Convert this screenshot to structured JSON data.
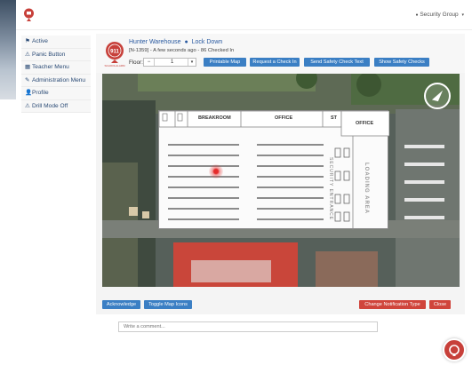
{
  "colors": {
    "brand_red": "#c7403a",
    "link_blue": "#2a5aa0",
    "button_blue": "#3b7fc4",
    "button_red": "#d0443b"
  },
  "topbar": {
    "user_menu": "Security Group",
    "logo_icon": "alarm-logo-icon"
  },
  "sidebar": {
    "items": [
      {
        "label": "Active",
        "icon": "flag-icon"
      },
      {
        "label": "Panic Button",
        "icon": "warning-icon"
      },
      {
        "label": "Teacher Menu",
        "icon": "building-icon"
      },
      {
        "label": "Administration Menu",
        "icon": "wrench-icon"
      },
      {
        "label": "Profile",
        "icon": "user-icon"
      },
      {
        "label": "Drill Mode Off",
        "icon": "warning-icon"
      }
    ]
  },
  "alert": {
    "title": "Hunter Warehouse",
    "status": "Lock Down",
    "subtitle": "[N-1359] - A few seconds ago - 86 Checked In",
    "badge_text": "911",
    "badge_caption": "SCHOOLALARM",
    "floor_label": "Floor:",
    "floor_value": "1"
  },
  "toolbar": {
    "printable_map": "Printable Map",
    "request_checkin": "Request a Check In",
    "send_safety_checklist": "Send Safety Check Text",
    "show_safety_checks": "Show Safety Checks"
  },
  "floorplan": {
    "rooms": [
      "BREAKROOM",
      "OFFICE",
      "ST",
      "OFFICE"
    ],
    "vertical_labels": [
      "SECURITY ENTRANCE",
      "LOADING AREA"
    ]
  },
  "footer": {
    "acknowledge": "Acknowledge",
    "toggle_icons": "Toggle Map Icons",
    "change_type": "Change Notification Type",
    "close": "Close",
    "comment_placeholder": "Write a comment..."
  }
}
